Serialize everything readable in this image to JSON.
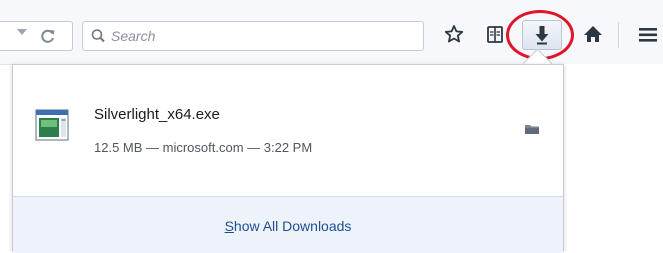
{
  "toolbar": {
    "search_placeholder": "Search",
    "icons": [
      "dropmarker-icon",
      "reload-icon",
      "search-icon",
      "bookmark-star-icon",
      "reading-list-icon",
      "download-arrow-icon",
      "home-icon",
      "menu-icon"
    ]
  },
  "downloads_panel": {
    "items": [
      {
        "file_name": "Silverlight_x64.exe",
        "status": "12.5 MB — microsoft.com — 3:22 PM",
        "icon": "exe-file-icon",
        "action_icon": "folder-icon"
      }
    ],
    "footer_prefix": "S",
    "footer_rest": "how All Downloads"
  },
  "colors": {
    "highlight_circle": "#e0152a",
    "link": "#1c4f95",
    "footer_bg": "#eef3fa",
    "toolbar_bg": "#f6f8fb"
  }
}
